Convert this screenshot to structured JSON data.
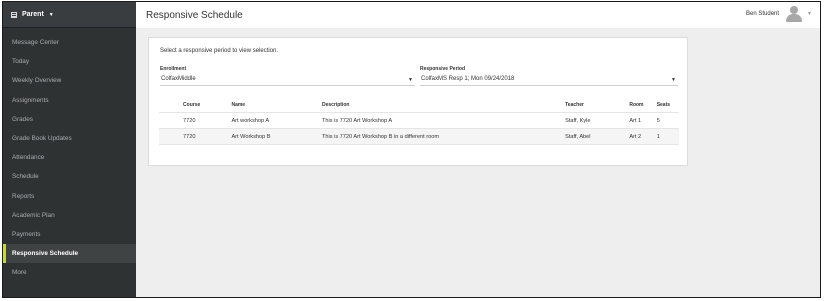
{
  "app": {
    "menu_label": "Parent",
    "menu_icon": "grid-icon"
  },
  "sidebar": {
    "items": [
      {
        "label": "Message Center",
        "active": false
      },
      {
        "label": "Today",
        "active": false
      },
      {
        "label": "Weekly Overview",
        "active": false
      },
      {
        "label": "Assignments",
        "active": false
      },
      {
        "label": "Grades",
        "active": false
      },
      {
        "label": "Grade Book Updates",
        "active": false
      },
      {
        "label": "Attendance",
        "active": false
      },
      {
        "label": "Schedule",
        "active": false
      },
      {
        "label": "Reports",
        "active": false
      },
      {
        "label": "Academic Plan",
        "active": false
      },
      {
        "label": "Payments",
        "active": false
      },
      {
        "label": "Responsive Schedule",
        "active": true
      },
      {
        "label": "More",
        "active": false
      }
    ]
  },
  "header": {
    "title": "Responsive Schedule",
    "user_name": "Ben Student"
  },
  "main": {
    "instruction": "Select a responsive period to view selection.",
    "enrollment": {
      "label": "Enrollment",
      "value": "ColfaxMiddle"
    },
    "period": {
      "label": "Responsive Period",
      "value": "ColfaxMS Resp 1; Mon 09/24/2018"
    },
    "table": {
      "headers": [
        "",
        "Course",
        "Name",
        "Description",
        "Teacher",
        "Room",
        "Seats"
      ],
      "rows": [
        [
          "",
          "7720",
          "Art workshop A",
          "This is 7720 Art Workshop A",
          "Staff, Kyle",
          "Art 1",
          "5"
        ],
        [
          "",
          "7720",
          "Art Workshop B",
          "This is 7720 Art Workshop B in a different room",
          "Staff, Abel",
          "Art 2",
          "1"
        ]
      ]
    }
  },
  "colors": {
    "sidebar_bg": "#2f3233",
    "active_accent": "#c7d82e",
    "content_bg": "#eeeeee"
  }
}
